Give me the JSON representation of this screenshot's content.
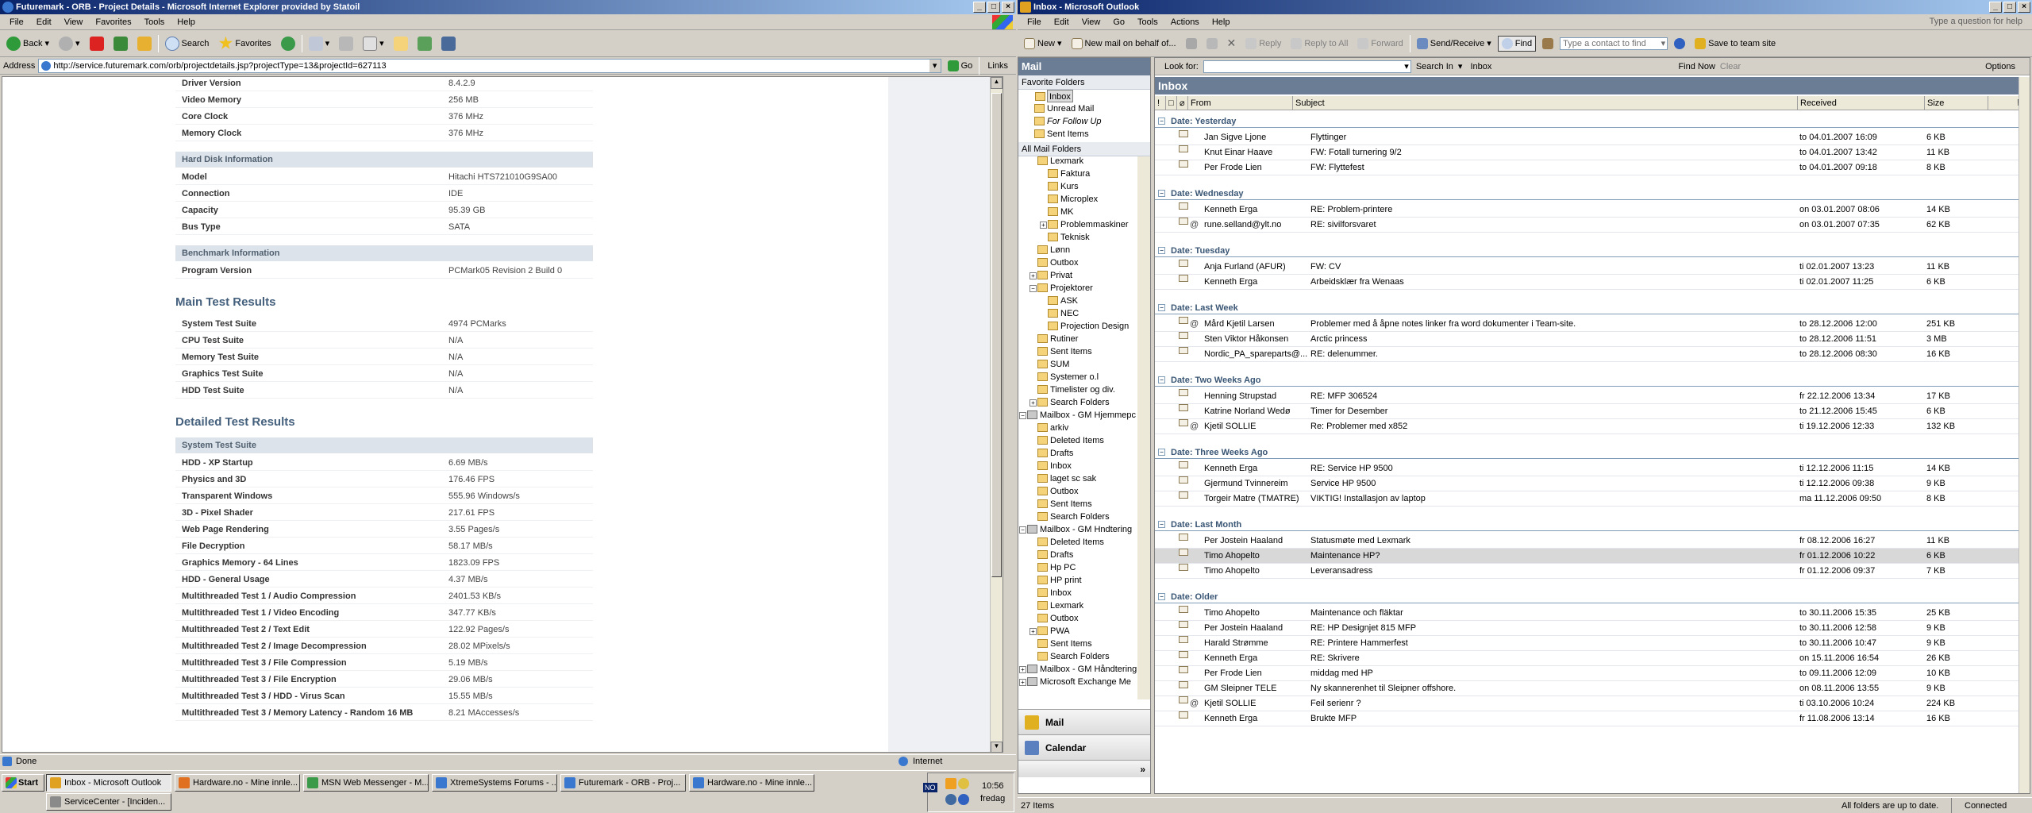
{
  "ie": {
    "title": "Futuremark - ORB - Project Details - Microsoft Internet Explorer provided by Statoil",
    "menu": [
      "File",
      "Edit",
      "View",
      "Favorites",
      "Tools",
      "Help"
    ],
    "toolbar": {
      "back": "Back",
      "search": "Search",
      "favorites": "Favorites"
    },
    "address_label": "Address",
    "url": "http://service.futuremark.com/orb/projectdetails.jsp?projectType=13&projectId=627113",
    "go": "Go",
    "links": "Links",
    "status": "Done",
    "zone": "Internet",
    "top_rows": [
      {
        "k": "Driver Version",
        "v": "8.4.2.9"
      },
      {
        "k": "Video Memory",
        "v": "256 MB"
      },
      {
        "k": "Core Clock",
        "v": "376 MHz"
      },
      {
        "k": "Memory Clock",
        "v": "376 MHz"
      }
    ],
    "hdd_head": "Hard Disk Information",
    "hdd_rows": [
      {
        "k": "Model",
        "v": "Hitachi HTS721010G9SA00"
      },
      {
        "k": "Connection",
        "v": "IDE"
      },
      {
        "k": "Capacity",
        "v": "95.39 GB"
      },
      {
        "k": "Bus Type",
        "v": "SATA"
      }
    ],
    "bench_head": "Benchmark Information",
    "bench_rows": [
      {
        "k": "Program Version",
        "v": "PCMark05 Revision 2 Build 0"
      }
    ],
    "main_title": "Main Test Results",
    "main_rows": [
      {
        "k": "System Test Suite",
        "v": "4974 PCMarks"
      },
      {
        "k": "CPU Test Suite",
        "v": "N/A"
      },
      {
        "k": "Memory Test Suite",
        "v": "N/A"
      },
      {
        "k": "Graphics Test Suite",
        "v": "N/A"
      },
      {
        "k": "HDD Test Suite",
        "v": "N/A"
      }
    ],
    "detail_title": "Detailed Test Results",
    "sys_head": "System Test Suite",
    "detail_rows": [
      {
        "k": "HDD - XP Startup",
        "v": "6.69 MB/s"
      },
      {
        "k": "Physics and 3D",
        "v": "176.46 FPS"
      },
      {
        "k": "Transparent Windows",
        "v": "555.96 Windows/s"
      },
      {
        "k": "3D - Pixel Shader",
        "v": "217.61 FPS"
      },
      {
        "k": "Web Page Rendering",
        "v": "3.55 Pages/s"
      },
      {
        "k": "File Decryption",
        "v": "58.17 MB/s"
      },
      {
        "k": "Graphics Memory - 64 Lines",
        "v": "1823.09 FPS"
      },
      {
        "k": "HDD - General Usage",
        "v": "4.37 MB/s"
      },
      {
        "k": "Multithreaded Test 1 / Audio Compression",
        "v": "2401.53 KB/s"
      },
      {
        "k": "Multithreaded Test 1 / Video Encoding",
        "v": "347.77 KB/s"
      },
      {
        "k": "Multithreaded Test 2 / Text Edit",
        "v": "122.92 Pages/s"
      },
      {
        "k": "Multithreaded Test 2 / Image Decompression",
        "v": "28.02 MPixels/s"
      },
      {
        "k": "Multithreaded Test 3 / File Compression",
        "v": "5.19 MB/s"
      },
      {
        "k": "Multithreaded Test 3 / File Encryption",
        "v": "29.06 MB/s"
      },
      {
        "k": "Multithreaded Test 3 / HDD - Virus Scan",
        "v": "15.55 MB/s"
      },
      {
        "k": "Multithreaded Test 3 / Memory Latency - Random 16 MB",
        "v": "8.21 MAccesses/s"
      }
    ]
  },
  "taskbar": {
    "start": "Start",
    "tasks": [
      "Inbox - Microsoft Outlook",
      "Hardware.no - Mine innle...",
      "MSN Web Messenger - M...",
      "XtremeSystems Forums - ...",
      "Futuremark - ORB - Proj...",
      "Hardware.no - Mine innle...",
      "ServiceCenter - [Inciden..."
    ],
    "lang": "NO",
    "time": "10:56",
    "day": "fredag"
  },
  "outlook": {
    "title": "Inbox - Microsoft Outlook",
    "menu": [
      "File",
      "Edit",
      "View",
      "Go",
      "Tools",
      "Actions",
      "Help"
    ],
    "question": "Type a question for help",
    "toolbar": {
      "new": "New",
      "new_behalf": "New mail on behalf of...",
      "reply": "Reply",
      "reply_all": "Reply to All",
      "forward": "Forward",
      "send_receive": "Send/Receive",
      "find": "Find",
      "contact": "Type a contact to find",
      "save_team": "Save to team site"
    },
    "nav_title": "Mail",
    "fav_title": "Favorite Folders",
    "favorites": [
      "Inbox",
      "Unread Mail",
      "For Follow Up",
      "Sent Items"
    ],
    "all_title": "All Mail Folders",
    "folders": [
      "Lexmark",
      "Faktura",
      "Kurs",
      "Microplex",
      "MK",
      "Problemmaskiner",
      "Teknisk",
      "Lønn",
      "Outbox",
      "Privat",
      "Projektorer",
      "ASK",
      "NEC",
      "Projection Design",
      "Rutiner",
      "Sent Items",
      "SUM",
      "Systemer o.l",
      "Timelister og div.",
      "Search Folders",
      "Mailbox - GM Hjemmepc",
      "arkiv",
      "Deleted Items",
      "Drafts",
      "Inbox",
      "laget sc sak",
      "Outbox",
      "Sent Items",
      "Search Folders",
      "Mailbox - GM Hndtering",
      "Deleted Items",
      "Drafts",
      "Hp PC",
      "HP print",
      "Inbox",
      "Lexmark",
      "Outbox",
      "PWA",
      "Sent Items",
      "Search Folders",
      "Mailbox - GM Håndtering",
      "Microsoft Exchange Me"
    ],
    "nav_mail": "Mail",
    "nav_calendar": "Calendar",
    "look_for": "Look for:",
    "search_in": "Search In",
    "search_in_val": "Inbox",
    "find_now": "Find Now",
    "clear": "Clear",
    "options": "Options",
    "inbox_title": "Inbox",
    "cols": {
      "from": "From",
      "subject": "Subject",
      "received": "Received",
      "size": "Size"
    },
    "groups": [
      {
        "label": "Date: Yesterday",
        "rows": [
          {
            "from": "Jan Sigve Ljone",
            "subject": "Flyttinger",
            "received": "to 04.01.2007 16:09",
            "size": "6 KB"
          },
          {
            "from": "Knut Einar Haave",
            "subject": "FW: Fotall turnering 9/2",
            "received": "to 04.01.2007 13:42",
            "size": "11 KB"
          },
          {
            "from": "Per Frode Lien",
            "subject": "FW: Flyttefest",
            "received": "to 04.01.2007 09:18",
            "size": "8 KB"
          }
        ]
      },
      {
        "label": "Date: Wednesday",
        "rows": [
          {
            "from": "Kenneth Erga",
            "subject": "RE: Problem-printere",
            "received": "on 03.01.2007 08:06",
            "size": "14 KB"
          },
          {
            "from": "rune.selland@ylt.no",
            "subject": "RE: sivilforsvaret",
            "received": "on 03.01.2007 07:35",
            "size": "62 KB",
            "attach": true
          }
        ]
      },
      {
        "label": "Date: Tuesday",
        "rows": [
          {
            "from": "Anja Furland (AFUR)",
            "subject": "FW: CV",
            "received": "ti 02.01.2007 13:23",
            "size": "11 KB"
          },
          {
            "from": "Kenneth Erga",
            "subject": "Arbeidsklær fra Wenaas",
            "received": "ti 02.01.2007 11:25",
            "size": "6 KB"
          }
        ]
      },
      {
        "label": "Date: Last Week",
        "rows": [
          {
            "from": "Mård Kjetil Larsen",
            "subject": "Problemer med å åpne notes linker fra word dokumenter i Team-site.",
            "received": "to 28.12.2006 12:00",
            "size": "251 KB",
            "attach": true
          },
          {
            "from": "Sten Viktor Håkonsen",
            "subject": "Arctic princess",
            "received": "to 28.12.2006 11:51",
            "size": "3 MB"
          },
          {
            "from": "Nordic_PA_spareparts@...",
            "subject": "RE: delenummer.",
            "received": "to 28.12.2006 08:30",
            "size": "16 KB"
          }
        ]
      },
      {
        "label": "Date: Two Weeks Ago",
        "rows": [
          {
            "from": "Henning Strupstad",
            "subject": "RE: MFP 306524",
            "received": "fr 22.12.2006 13:34",
            "size": "17 KB"
          },
          {
            "from": "Katrine Norland Wedø",
            "subject": "Timer for Desember",
            "received": "to 21.12.2006 15:45",
            "size": "6 KB"
          },
          {
            "from": "Kjetil SOLLIE",
            "subject": "Re: Problemer med x852",
            "received": "ti 19.12.2006 12:33",
            "size": "132 KB",
            "attach": true
          }
        ]
      },
      {
        "label": "Date: Three Weeks Ago",
        "rows": [
          {
            "from": "Kenneth Erga",
            "subject": "RE: Service HP 9500",
            "received": "ti 12.12.2006 11:15",
            "size": "14 KB"
          },
          {
            "from": "Gjermund Tvinnereim",
            "subject": "Service HP 9500",
            "received": "ti 12.12.2006 09:38",
            "size": "9 KB"
          },
          {
            "from": "Torgeir Matre (TMATRE)",
            "subject": "VIKTIG! Installasjon av laptop",
            "received": "ma 11.12.2006 09:50",
            "size": "8 KB"
          }
        ]
      },
      {
        "label": "Date: Last Month",
        "rows": [
          {
            "from": "Per Jostein Haaland",
            "subject": "Statusmøte med Lexmark",
            "received": "fr 08.12.2006 16:27",
            "size": "11 KB"
          },
          {
            "from": "Timo Ahopelto",
            "subject": "Maintenance HP?",
            "received": "fr 01.12.2006 10:22",
            "size": "6 KB",
            "selected": true
          },
          {
            "from": "Timo Ahopelto",
            "subject": "Leveransadress",
            "received": "fr 01.12.2006 09:37",
            "size": "7 KB"
          }
        ]
      },
      {
        "label": "Date: Older",
        "rows": [
          {
            "from": "Timo Ahopelto",
            "subject": "Maintenance och fläktar",
            "received": "to 30.11.2006 15:35",
            "size": "25 KB"
          },
          {
            "from": "Per Jostein Haaland",
            "subject": "RE: HP Designjet 815 MFP",
            "received": "to 30.11.2006 12:58",
            "size": "9 KB"
          },
          {
            "from": "Harald Strømme",
            "subject": "RE: Printere Hammerfest",
            "received": "to 30.11.2006 10:47",
            "size": "9 KB"
          },
          {
            "from": "Kenneth Erga",
            "subject": "RE: Skrivere",
            "received": "on 15.11.2006 16:54",
            "size": "26 KB"
          },
          {
            "from": "Per Frode Lien",
            "subject": "middag med HP",
            "received": "to 09.11.2006 12:09",
            "size": "10 KB"
          },
          {
            "from": "GM Sleipner TELE",
            "subject": "Ny skannerenhet til Sleipner offshore.",
            "received": "on 08.11.2006 13:55",
            "size": "9 KB"
          },
          {
            "from": "Kjetil SOLLIE",
            "subject": "Feil serienr ?",
            "received": "ti 03.10.2006 10:24",
            "size": "224 KB",
            "attach": true
          },
          {
            "from": "Kenneth Erga",
            "subject": "Brukte MFP",
            "received": "fr 11.08.2006 13:14",
            "size": "16 KB"
          }
        ]
      }
    ],
    "status_items": "27 Items",
    "status_sync": "All folders are up to date.",
    "status_conn": "Connected"
  },
  "colors": {
    "title_start": "#0a246a",
    "title_end": "#a6caf0",
    "nav_header": "#6b7d94",
    "section_head": "#dde3ea",
    "heading": "#44607d"
  }
}
